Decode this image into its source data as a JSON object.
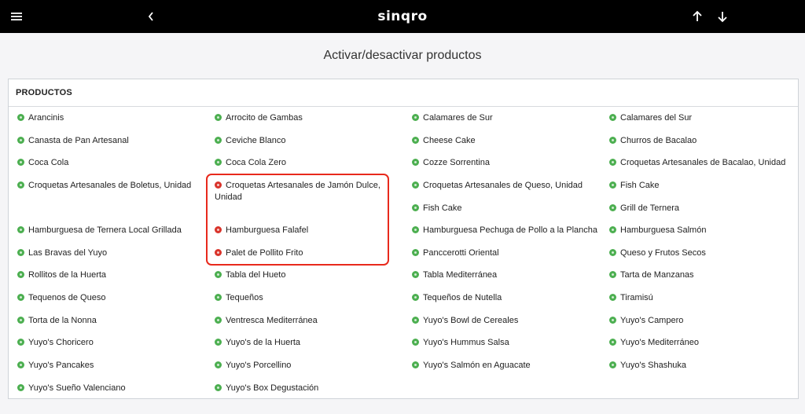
{
  "app": {
    "logo": "sinqro"
  },
  "page": {
    "title": "Activar/desactivar productos"
  },
  "panel": {
    "header": "PRODUCTOS"
  },
  "colors": {
    "active": "#4caf50",
    "inactive": "#d9342b",
    "highlight": "#e8291c"
  },
  "icons": {
    "menu": "menu-icon",
    "back": "chevron-left-icon",
    "up": "arrow-up-icon",
    "down": "arrow-down-icon"
  },
  "columns": [
    [
      {
        "label": "Arancinis",
        "active": true
      },
      {
        "label": "Canasta de Pan Artesanal",
        "active": true
      },
      {
        "label": "Coca Cola",
        "active": true
      },
      {
        "label": "Croquetas Artesanales de Boletus, Unidad",
        "active": true
      },
      {
        "label": "Hamburguesa de Ternera Local Grillada",
        "active": true
      },
      {
        "label": "Las Bravas del Yuyo",
        "active": true
      },
      {
        "label": "Rollitos de la Huerta",
        "active": true
      },
      {
        "label": "Tequenos de Queso",
        "active": true
      },
      {
        "label": "Torta de la Nonna",
        "active": true
      },
      {
        "label": "Yuyo's Choricero",
        "active": true
      },
      {
        "label": "Yuyo's Pancakes",
        "active": true
      },
      {
        "label": "Yuyo's Sueño Valenciano",
        "active": true
      }
    ],
    [
      {
        "label": "Arrocito de Gambas",
        "active": true
      },
      {
        "label": "Ceviche Blanco",
        "active": true
      },
      {
        "label": "Coca Cola Zero",
        "active": true
      },
      {
        "label": "Croquetas Artesanales de Jamón Dulce, Unidad",
        "active": false
      },
      {
        "label": "Hamburguesa Falafel",
        "active": false
      },
      {
        "label": "Palet de Pollito Frito",
        "active": false
      },
      {
        "label": "Tabla del Hueto",
        "active": true
      },
      {
        "label": "Tequeños",
        "active": true
      },
      {
        "label": "Ventresca Mediterránea",
        "active": true
      },
      {
        "label": "Yuyo's de la Huerta",
        "active": true
      },
      {
        "label": "Yuyo's Porcellino",
        "active": true
      },
      {
        "label": "Yuyo's Box Degustación",
        "active": true
      }
    ],
    [
      {
        "label": "Calamares de Sur",
        "active": true
      },
      {
        "label": "Cheese Cake",
        "active": true
      },
      {
        "label": "Cozze Sorrentina",
        "active": true
      },
      {
        "label": "Croquetas Artesanales de Queso, Unidad",
        "active": true
      },
      {
        "label": "Fish Cake",
        "active": true
      },
      {
        "label": "Hamburguesa Pechuga de Pollo a la Plancha",
        "active": true
      },
      {
        "label": "Panccerotti Oriental",
        "active": true
      },
      {
        "label": "Tabla Mediterránea",
        "active": true
      },
      {
        "label": "Tequeños de Nutella",
        "active": true
      },
      {
        "label": "Yuyo's Bowl de Cereales",
        "active": true
      },
      {
        "label": "Yuyo's Hummus Salsa",
        "active": true
      },
      {
        "label": "Yuyo's Salmón en Aguacate",
        "active": true
      }
    ],
    [
      {
        "label": "Calamares del Sur",
        "active": true
      },
      {
        "label": "Churros de Bacalao",
        "active": true
      },
      {
        "label": "Croquetas Artesanales de Bacalao, Unidad",
        "active": true
      },
      {
        "label": "Fish Cake",
        "active": true
      },
      {
        "label": "Grill de Ternera",
        "active": true
      },
      {
        "label": "Hamburguesa Salmón",
        "active": true
      },
      {
        "label": "Queso y Frutos Secos",
        "active": true
      },
      {
        "label": "Tarta de Manzanas",
        "active": true
      },
      {
        "label": "Tiramisú",
        "active": true
      },
      {
        "label": "Yuyo's Campero",
        "active": true
      },
      {
        "label": "Yuyo's Mediterráneo",
        "active": true
      },
      {
        "label": "Yuyo's Shashuka",
        "active": true
      }
    ]
  ]
}
